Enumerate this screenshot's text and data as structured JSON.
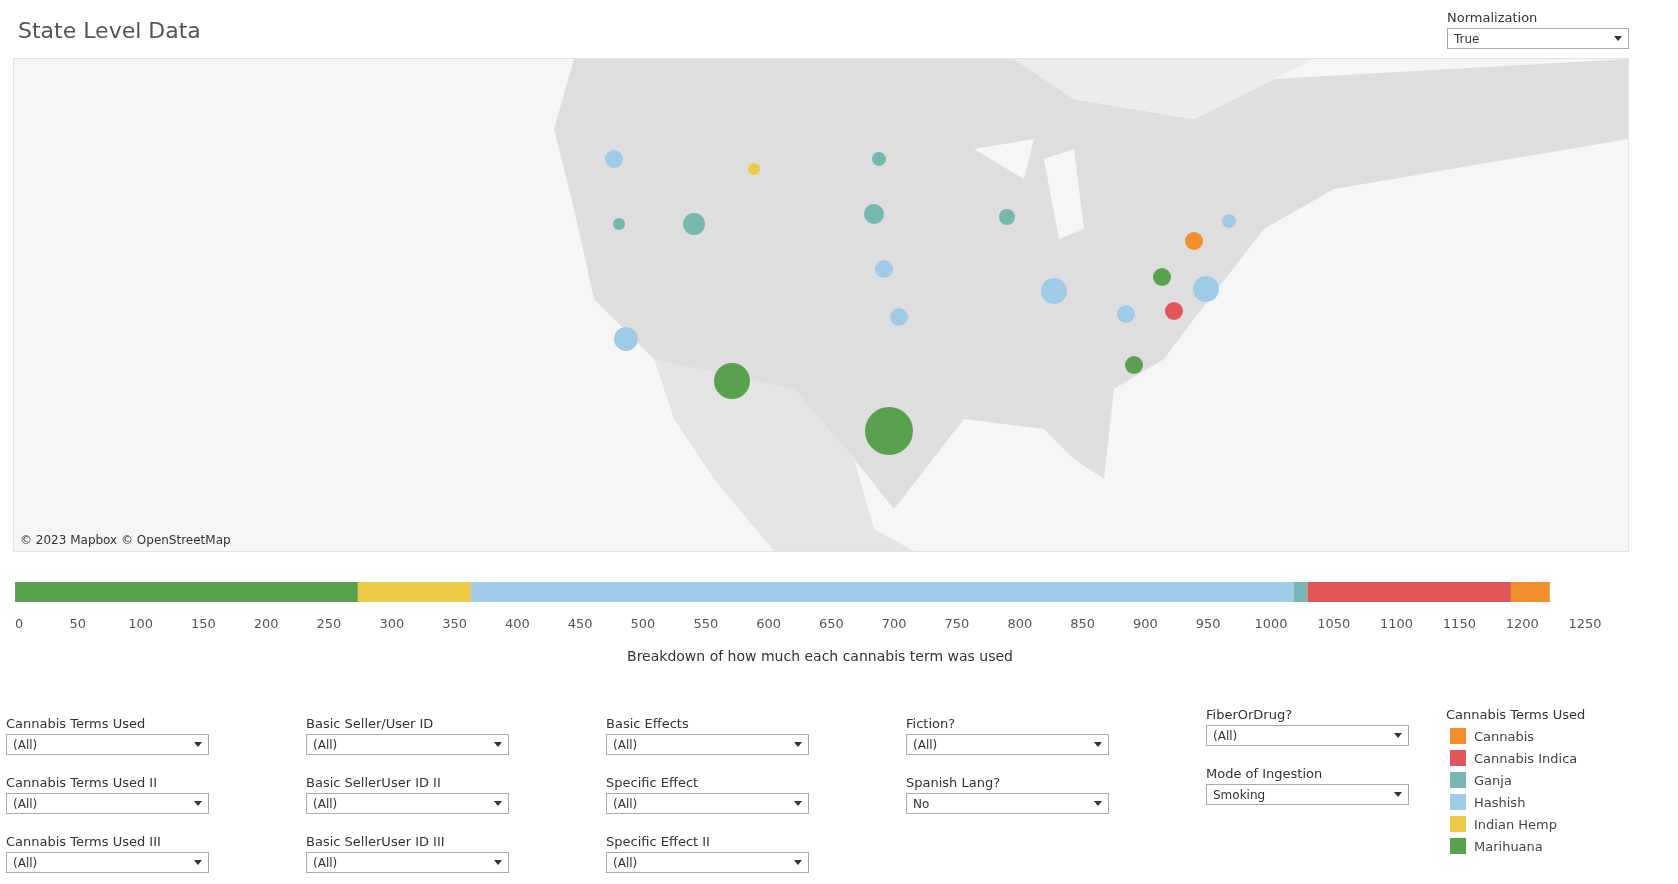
{
  "title": "State Level Data",
  "normalization": {
    "label": "Normalization",
    "value": "True"
  },
  "map": {
    "kind": "picture",
    "attribution": "© 2023 Mapbox © OpenStreetMap"
  },
  "chart_data": {
    "type": "bar",
    "orientation": "horizontal",
    "stacked": true,
    "xlabel": "Breakdown of how much each cannabis term was used",
    "xlim": [
      0,
      1250
    ],
    "xticks": [
      0,
      50,
      100,
      150,
      200,
      250,
      300,
      350,
      400,
      450,
      500,
      550,
      600,
      650,
      700,
      750,
      800,
      850,
      900,
      950,
      1000,
      1050,
      1100,
      1150,
      1200,
      1250
    ],
    "series": [
      {
        "color": "#59a14f",
        "values": [
          273
        ]
      },
      {
        "color": "#edc948",
        "values": [
          90
        ]
      },
      {
        "color": "#a0cbe8",
        "values": [
          655
        ]
      },
      {
        "color": "#76b7b2",
        "values": [
          11
        ]
      },
      {
        "color": "#e15759",
        "values": [
          162
        ]
      },
      {
        "color": "#f28e2b",
        "values": [
          31
        ]
      }
    ]
  },
  "filter_columns": [
    [
      {
        "label": "Cannabis Terms Used",
        "value": "(All)"
      },
      {
        "label": "Cannabis Terms Used II",
        "value": "(All)"
      },
      {
        "label": "Cannabis Terms Used III",
        "value": "(All)"
      }
    ],
    [
      {
        "label": "Basic Seller/User ID",
        "value": "(All)"
      },
      {
        "label": "Basic SellerUser ID II",
        "value": "(All)"
      },
      {
        "label": "Basic SellerUser ID III",
        "value": "(All)"
      }
    ],
    [
      {
        "label": "Basic Effects",
        "value": "(All)"
      },
      {
        "label": "Specific Effect",
        "value": "(All)"
      },
      {
        "label": "Specific Effect II",
        "value": "(All)"
      }
    ],
    [
      {
        "label": "Fiction?",
        "value": "(All)"
      },
      {
        "label": "Spanish Lang?",
        "value": "No"
      }
    ],
    [
      {
        "label": "FiberOrDrug?",
        "value": "(All)"
      },
      {
        "label": "Mode of Ingestion",
        "value": "Smoking"
      }
    ]
  ],
  "legend": {
    "title": "Cannabis Terms Used",
    "items": [
      {
        "label": "Cannabis",
        "color": "#f28e2b"
      },
      {
        "label": "Cannabis Indica",
        "color": "#e15759"
      },
      {
        "label": "Ganja",
        "color": "#76b7b2"
      },
      {
        "label": "Hashish",
        "color": "#a0cbe8"
      },
      {
        "label": "Indian Hemp",
        "color": "#edc948"
      },
      {
        "label": "Marihuana",
        "color": "#59a14f"
      }
    ]
  }
}
